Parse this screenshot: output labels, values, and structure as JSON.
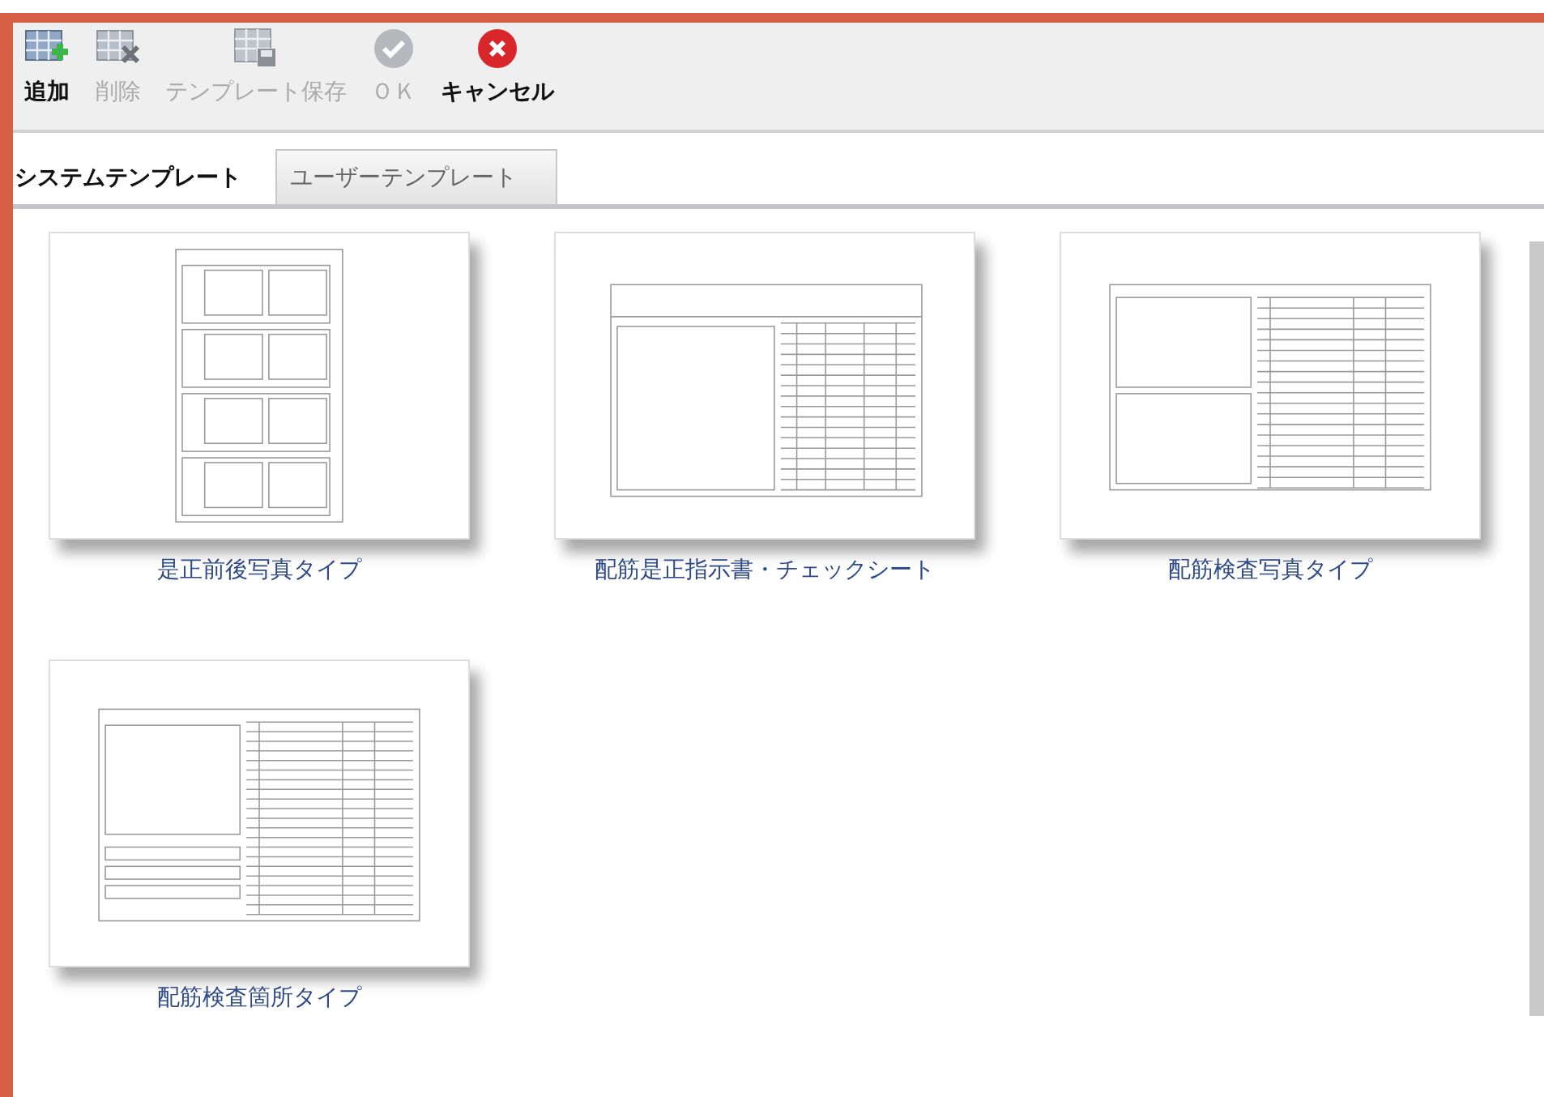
{
  "toolbar": {
    "buttons": [
      {
        "label": "追加",
        "kind": "add",
        "disabled": false
      },
      {
        "label": "削除",
        "kind": "delete",
        "disabled": true
      },
      {
        "label": "テンプレート保存",
        "kind": "save",
        "disabled": true
      },
      {
        "label": "ＯＫ",
        "kind": "ok",
        "disabled": true
      },
      {
        "label": "キャンセル",
        "kind": "cancel",
        "disabled": false
      }
    ]
  },
  "tabs": [
    {
      "label": "システムテンプレート",
      "selected": true
    },
    {
      "label": "ユーザーテンプレート",
      "selected": false
    }
  ],
  "templates": [
    {
      "name": "是正前後写真タイプ",
      "kind": "grid"
    },
    {
      "name": "配筋是正指示書・チェックシート",
      "kind": "sheet"
    },
    {
      "name": "配筋検査写真タイプ",
      "kind": "photo2"
    },
    {
      "name": "配筋検査箇所タイプ",
      "kind": "photo1"
    }
  ]
}
